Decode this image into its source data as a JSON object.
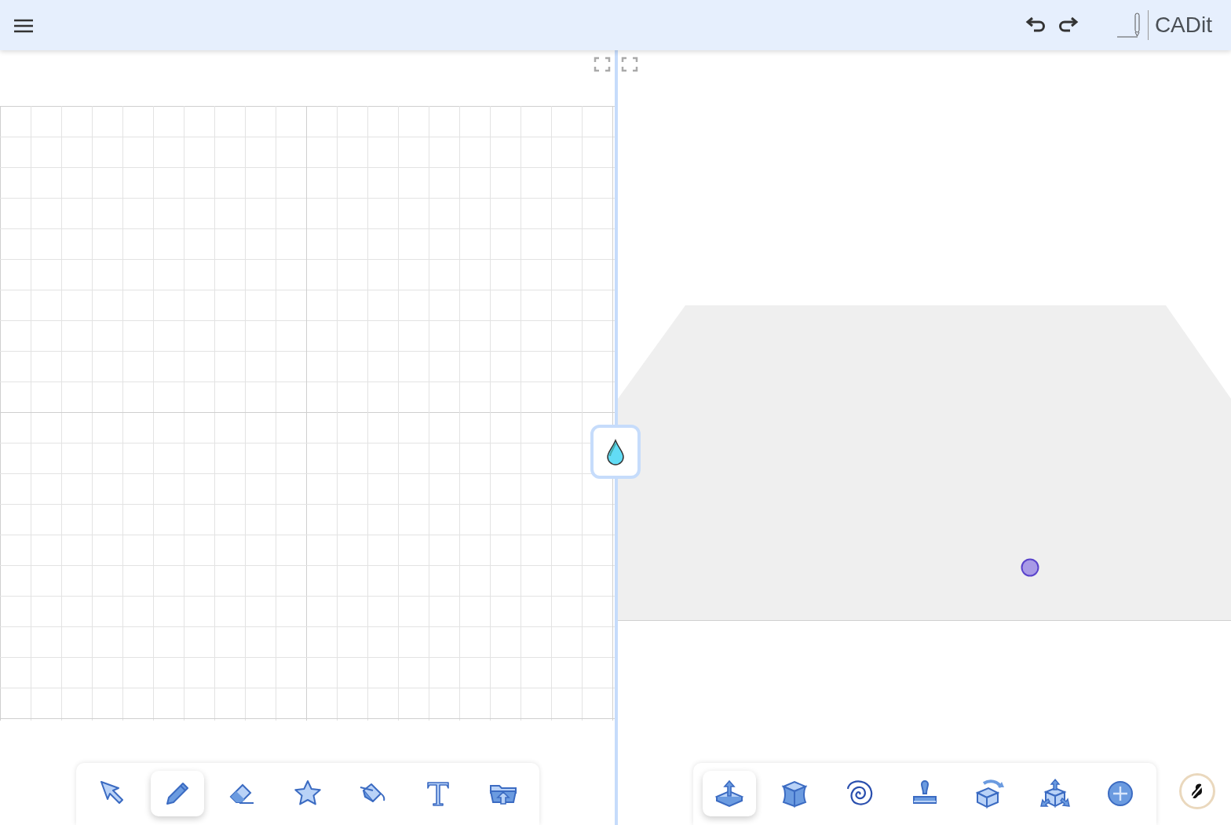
{
  "header": {
    "title": "CADit"
  },
  "sketch_tools": [
    {
      "kind": "select",
      "selected": false
    },
    {
      "kind": "pencil",
      "selected": true
    },
    {
      "kind": "eraser",
      "selected": false
    },
    {
      "kind": "star",
      "selected": false
    },
    {
      "kind": "paint",
      "selected": false
    },
    {
      "kind": "text",
      "selected": false
    },
    {
      "kind": "upload",
      "selected": false
    }
  ],
  "model_tools": [
    {
      "kind": "extrude",
      "selected": true
    },
    {
      "kind": "shape",
      "selected": false
    },
    {
      "kind": "spiral",
      "selected": false
    },
    {
      "kind": "stamp",
      "selected": false
    },
    {
      "kind": "rotate",
      "selected": false
    },
    {
      "kind": "scale",
      "selected": false
    },
    {
      "kind": "add",
      "selected": false
    }
  ]
}
